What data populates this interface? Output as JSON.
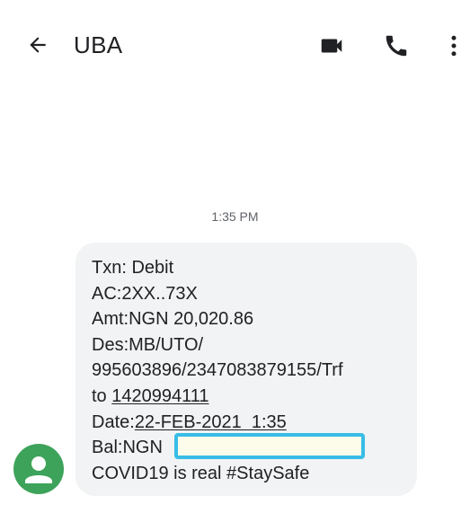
{
  "header": {
    "title": "UBA",
    "back_icon": "arrow-back-icon",
    "actions": [
      {
        "icon": "video-call-icon"
      },
      {
        "icon": "phone-call-icon"
      },
      {
        "icon": "more-vert-icon"
      }
    ]
  },
  "conversation": {
    "timestamp": "1:35 PM",
    "message": {
      "line1": "Txn: Debit",
      "line2": "AC:2XX..73X",
      "line3": "Amt:NGN 20,020.86",
      "line4": "Des:MB/UTO/",
      "line5": "995603896/2347083879155/Trf",
      "line6_prefix": "to ",
      "line6_link": "1420994111",
      "line7_prefix": "Date:",
      "line7_link": "22-FEB-2021  1:35",
      "line8": "Bal:NGN",
      "line9": "COVID19 is real #StaySafe"
    }
  },
  "colors": {
    "avatar": "#3da35a",
    "bubble": "#f1f3f4",
    "redaction_border": "#38bde7",
    "redaction_fill": "#fdfbe9"
  }
}
